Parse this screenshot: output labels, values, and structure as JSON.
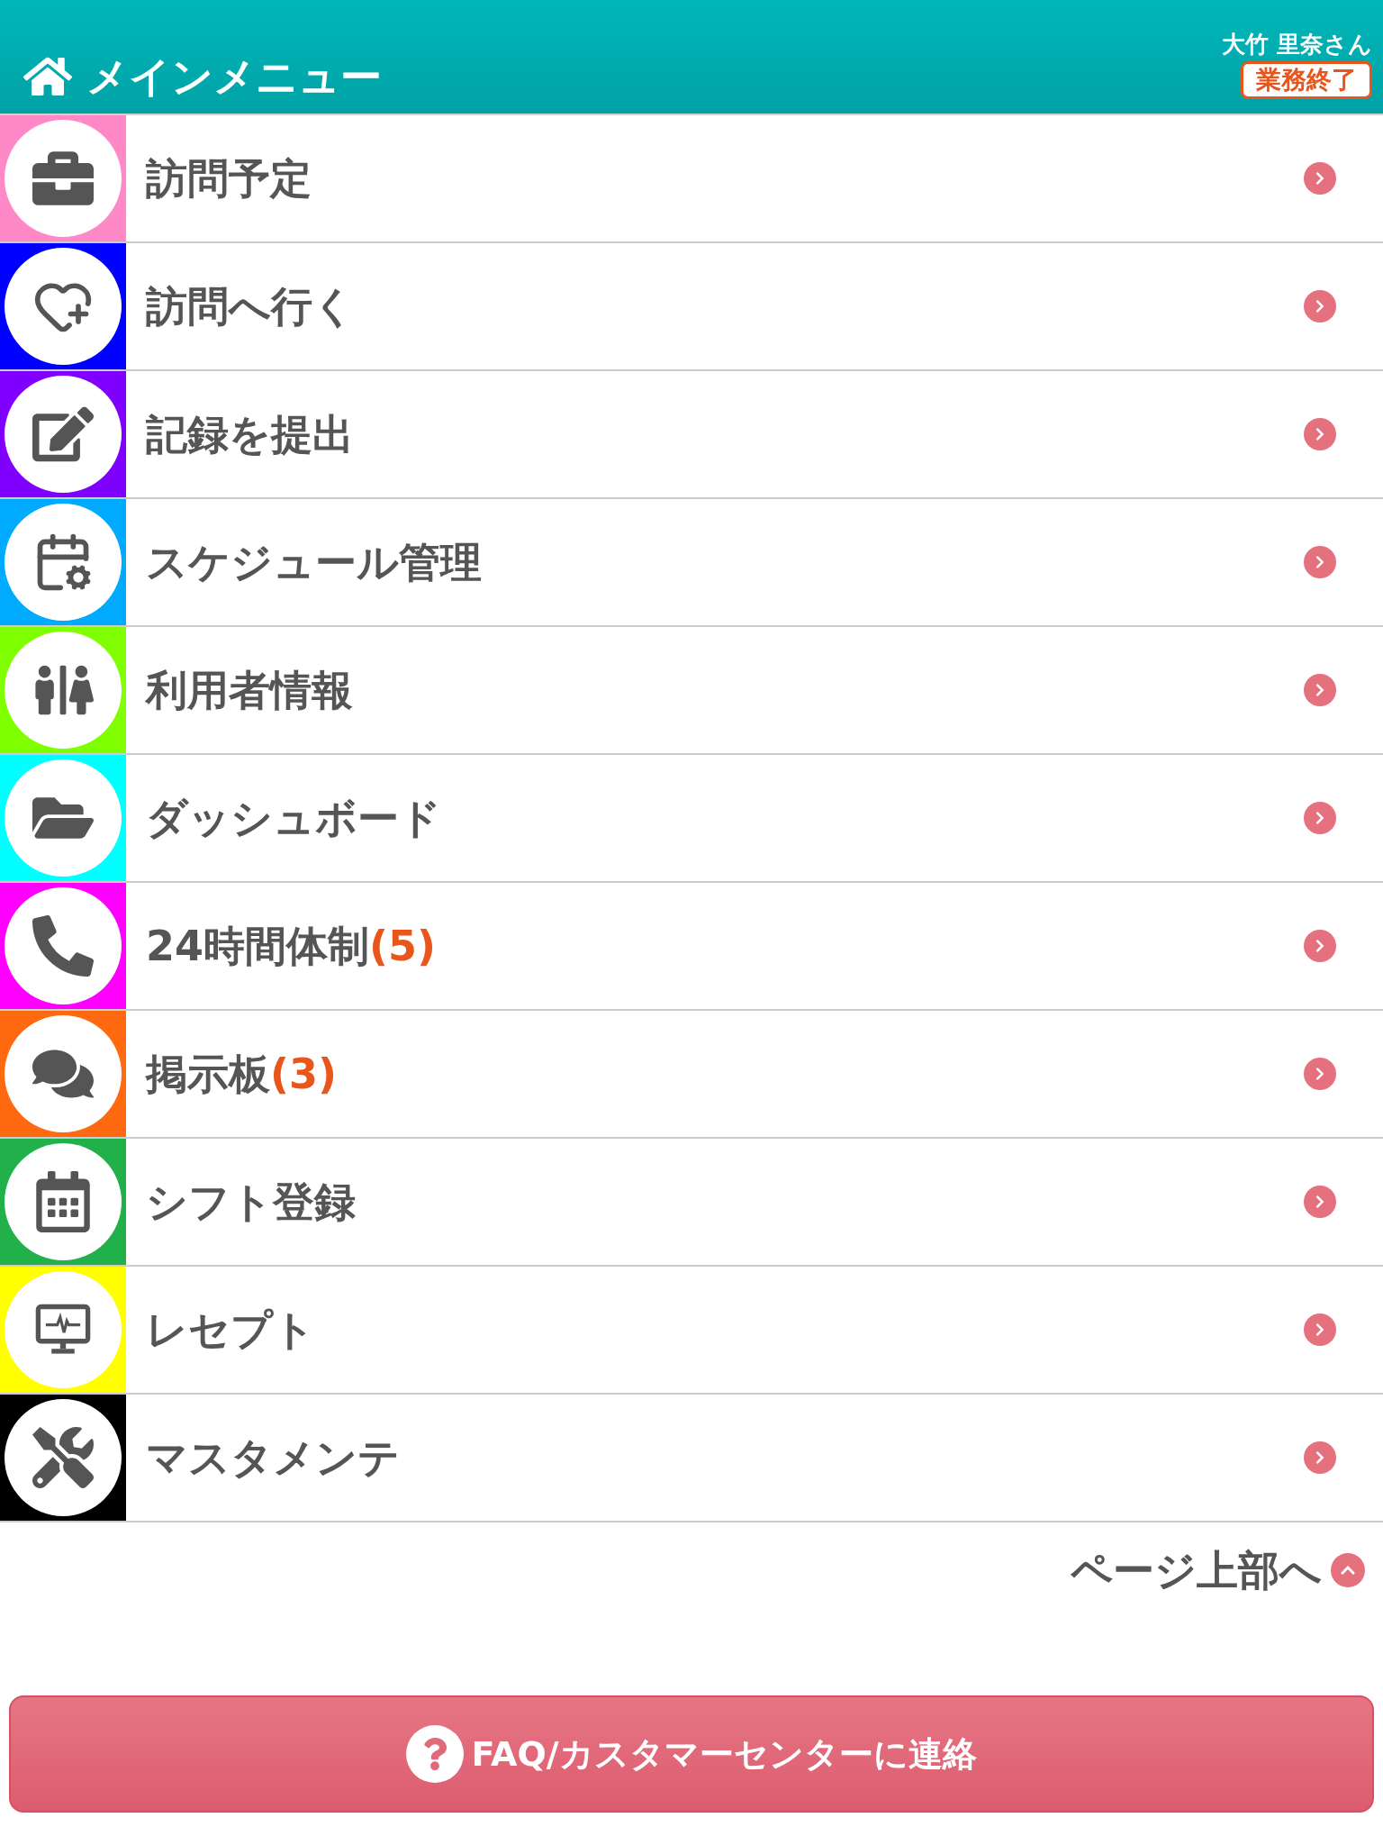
{
  "header": {
    "title": "メインメニュー",
    "user": "大竹 里奈さん",
    "end_button": "業務終了"
  },
  "menu": [
    {
      "label": "訪問予定",
      "kind": "briefcase",
      "color": "#ff88c6"
    },
    {
      "label": "訪問へ行く",
      "kind": "heart",
      "color": "#0000ff"
    },
    {
      "label": "記録を提出",
      "kind": "edit",
      "color": "#8000ff"
    },
    {
      "label": "スケジュール管理",
      "kind": "calendar-gear",
      "color": "#00aaff"
    },
    {
      "label": "利用者情報",
      "kind": "people",
      "color": "#80ff00"
    },
    {
      "label": "ダッシュボード",
      "kind": "folder",
      "color": "#00ffff"
    },
    {
      "label": "24時間体制",
      "count": "(5)",
      "kind": "phone",
      "color": "#ff00ff"
    },
    {
      "label": "掲示板",
      "count": "(3)",
      "kind": "chat",
      "color": "#ff6a10"
    },
    {
      "label": "シフト登録",
      "kind": "calendar",
      "color": "#22b04a"
    },
    {
      "label": "レセプト",
      "kind": "monitor",
      "color": "#ffff00"
    },
    {
      "label": "マスタメンテ",
      "kind": "tools",
      "color": "#000000"
    }
  ],
  "page_top": "ページ上部へ",
  "contact_button": "FAQ/カスタマーセンターに連絡"
}
